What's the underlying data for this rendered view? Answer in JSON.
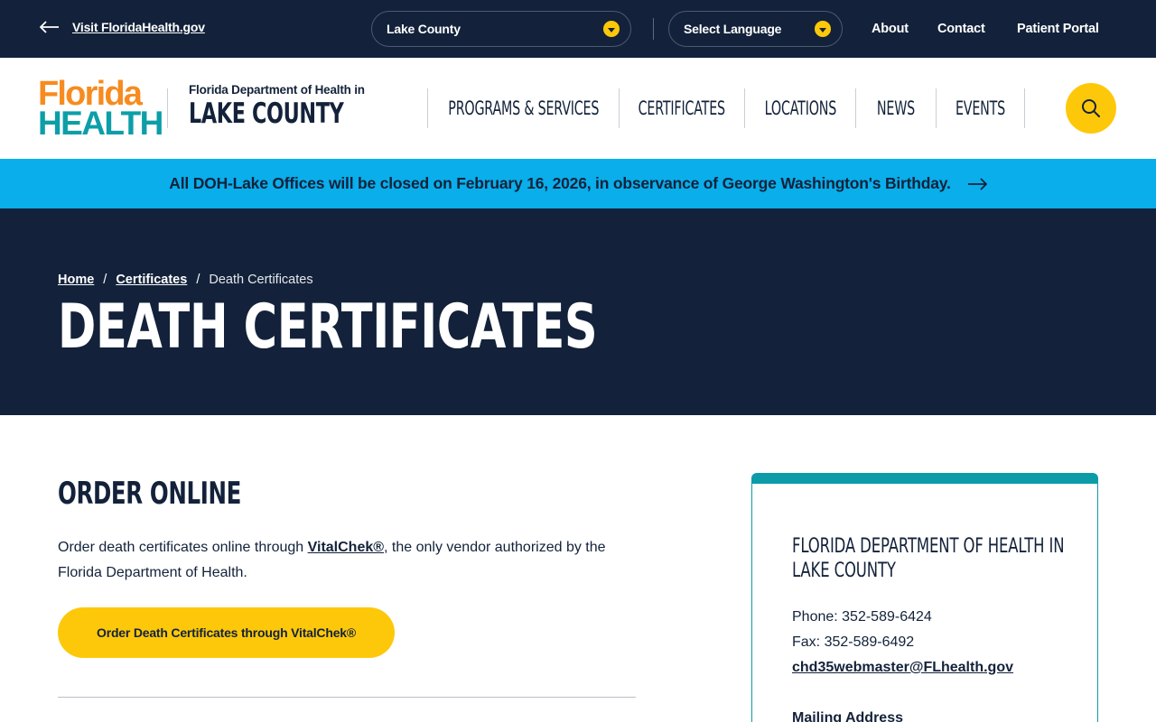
{
  "utility": {
    "back_link": "Visit FloridaHealth.gov",
    "county_select": "Lake County",
    "language_select": "Select Language",
    "links": [
      "About",
      "Contact",
      "Patient Portal"
    ]
  },
  "header": {
    "logo_line1": "Florida",
    "logo_line2": "HEALTH",
    "dept_small": "Florida Department of Health in",
    "dept_big": "LAKE COUNTY",
    "nav": [
      "PROGRAMS & SERVICES",
      "CERTIFICATES",
      "LOCATIONS",
      "NEWS",
      "EVENTS"
    ],
    "search_icon": "search-icon"
  },
  "alert": {
    "text": "All DOH-Lake Offices will be closed on February 16, 2026, in observance of George Washington's Birthday.",
    "icon": "arrow-right-icon"
  },
  "hero": {
    "breadcrumbs": [
      "Home",
      "Certificates",
      "Death Certificates"
    ],
    "title": "DEATH CERTIFICATES"
  },
  "main": {
    "heading": "ORDER ONLINE",
    "para_before": "Order death certificates online through ",
    "para_link": "VitalChek®",
    "para_after": ", the only vendor authorized by the Florida Department of Health.",
    "cta": "Order Death Certificates through VitalChek®"
  },
  "sidebar": {
    "title": "FLORIDA DEPARTMENT OF HEALTH IN LAKE COUNTY",
    "phone": "Phone: 352-589-6424",
    "fax": "Fax: 352-589-6492",
    "email": "chd35webmaster@FLhealth.gov",
    "mailing_heading": "Mailing Address"
  },
  "colors": {
    "navy": "#13223a",
    "yellow": "#fec80a",
    "alert_blue": "#09aeeb",
    "teal": "#0c9ca8",
    "orange": "#f78b1f"
  }
}
